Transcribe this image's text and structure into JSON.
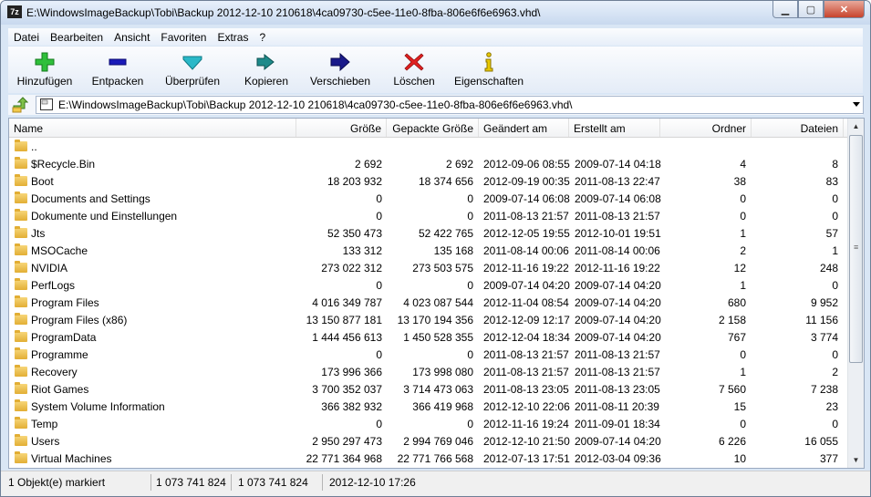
{
  "window": {
    "app_icon_text": "7z",
    "title": "E:\\WindowsImageBackup\\Tobi\\Backup 2012-12-10 210618\\4ca09730-c5ee-11e0-8fba-806e6f6e6963.vhd\\",
    "close_glyph": "✕",
    "minimize_glyph": "▁",
    "maximize_glyph": "▢"
  },
  "menu": [
    "Datei",
    "Bearbeiten",
    "Ansicht",
    "Favoriten",
    "Extras",
    "?"
  ],
  "toolbar": [
    {
      "label": "Hinzufügen",
      "icon": "add-icon",
      "color": "#2fbf3a"
    },
    {
      "label": "Entpacken",
      "icon": "extract-icon",
      "color": "#1a1ab8"
    },
    {
      "label": "Überprüfen",
      "icon": "test-icon",
      "color": "#2ab8c8"
    },
    {
      "label": "Kopieren",
      "icon": "copy-icon",
      "color": "#1e8a8a"
    },
    {
      "label": "Verschieben",
      "icon": "move-icon",
      "color": "#1a1a8a"
    },
    {
      "label": "Löschen",
      "icon": "delete-icon",
      "color": "#e02020"
    },
    {
      "label": "Eigenschaften",
      "icon": "info-icon",
      "color": "#e8c800"
    }
  ],
  "address": {
    "path": "E:\\WindowsImageBackup\\Tobi\\Backup 2012-12-10 210618\\4ca09730-c5ee-11e0-8fba-806e6f6e6963.vhd\\"
  },
  "columns": [
    "Name",
    "Größe",
    "Gepackte Größe",
    "Geändert am",
    "Erstellt am",
    "Ordner",
    "Dateien"
  ],
  "rows": [
    {
      "name": "..",
      "size": "",
      "packed": "",
      "modified": "",
      "created": "",
      "folders": "",
      "files": ""
    },
    {
      "name": "$Recycle.Bin",
      "size": "2 692",
      "packed": "2 692",
      "modified": "2012-09-06 08:55",
      "created": "2009-07-14 04:18",
      "folders": "4",
      "files": "8"
    },
    {
      "name": "Boot",
      "size": "18 203 932",
      "packed": "18 374 656",
      "modified": "2012-09-19 00:35",
      "created": "2011-08-13 22:47",
      "folders": "38",
      "files": "83"
    },
    {
      "name": "Documents and Settings",
      "size": "0",
      "packed": "0",
      "modified": "2009-07-14 06:08",
      "created": "2009-07-14 06:08",
      "folders": "0",
      "files": "0"
    },
    {
      "name": "Dokumente und Einstellungen",
      "size": "0",
      "packed": "0",
      "modified": "2011-08-13 21:57",
      "created": "2011-08-13 21:57",
      "folders": "0",
      "files": "0"
    },
    {
      "name": "Jts",
      "size": "52 350 473",
      "packed": "52 422 765",
      "modified": "2012-12-05 19:55",
      "created": "2012-10-01 19:51",
      "folders": "1",
      "files": "57"
    },
    {
      "name": "MSOCache",
      "size": "133 312",
      "packed": "135 168",
      "modified": "2011-08-14 00:06",
      "created": "2011-08-14 00:06",
      "folders": "2",
      "files": "1"
    },
    {
      "name": "NVIDIA",
      "size": "273 022 312",
      "packed": "273 503 575",
      "modified": "2012-11-16 19:22",
      "created": "2012-11-16 19:22",
      "folders": "12",
      "files": "248"
    },
    {
      "name": "PerfLogs",
      "size": "0",
      "packed": "0",
      "modified": "2009-07-14 04:20",
      "created": "2009-07-14 04:20",
      "folders": "1",
      "files": "0"
    },
    {
      "name": "Program Files",
      "size": "4 016 349 787",
      "packed": "4 023 087 544",
      "modified": "2012-11-04 08:54",
      "created": "2009-07-14 04:20",
      "folders": "680",
      "files": "9 952"
    },
    {
      "name": "Program Files (x86)",
      "size": "13 150 877 181",
      "packed": "13 170 194 356",
      "modified": "2012-12-09 12:17",
      "created": "2009-07-14 04:20",
      "folders": "2 158",
      "files": "11 156"
    },
    {
      "name": "ProgramData",
      "size": "1 444 456 613",
      "packed": "1 450 528 355",
      "modified": "2012-12-04 18:34",
      "created": "2009-07-14 04:20",
      "folders": "767",
      "files": "3 774"
    },
    {
      "name": "Programme",
      "size": "0",
      "packed": "0",
      "modified": "2011-08-13 21:57",
      "created": "2011-08-13 21:57",
      "folders": "0",
      "files": "0"
    },
    {
      "name": "Recovery",
      "size": "173 996 366",
      "packed": "173 998 080",
      "modified": "2011-08-13 21:57",
      "created": "2011-08-13 21:57",
      "folders": "1",
      "files": "2"
    },
    {
      "name": "Riot Games",
      "size": "3 700 352 037",
      "packed": "3 714 473 063",
      "modified": "2011-08-13 23:05",
      "created": "2011-08-13 23:05",
      "folders": "7 560",
      "files": "7 238"
    },
    {
      "name": "System Volume Information",
      "size": "366 382 932",
      "packed": "366 419 968",
      "modified": "2012-12-10 22:06",
      "created": "2011-08-11 20:39",
      "folders": "15",
      "files": "23"
    },
    {
      "name": "Temp",
      "size": "0",
      "packed": "0",
      "modified": "2012-11-16 19:24",
      "created": "2011-09-01 18:34",
      "folders": "0",
      "files": "0"
    },
    {
      "name": "Users",
      "size": "2 950 297 473",
      "packed": "2 994 769 046",
      "modified": "2012-12-10 21:50",
      "created": "2009-07-14 04:20",
      "folders": "6 226",
      "files": "16 055"
    },
    {
      "name": "Virtual Machines",
      "size": "22 771 364 968",
      "packed": "22 771 766 568",
      "modified": "2012-07-13 17:51",
      "created": "2012-03-04 09:36",
      "folders": "10",
      "files": "377"
    }
  ],
  "scrollbar": {
    "up_glyph": "▲",
    "down_glyph": "▼",
    "grip_glyph": "≡"
  },
  "status": {
    "selection": "1 Objekt(e) markiert",
    "size": "1 073 741 824",
    "packed": "1 073 741 824",
    "date": "2012-12-10 17:26"
  }
}
